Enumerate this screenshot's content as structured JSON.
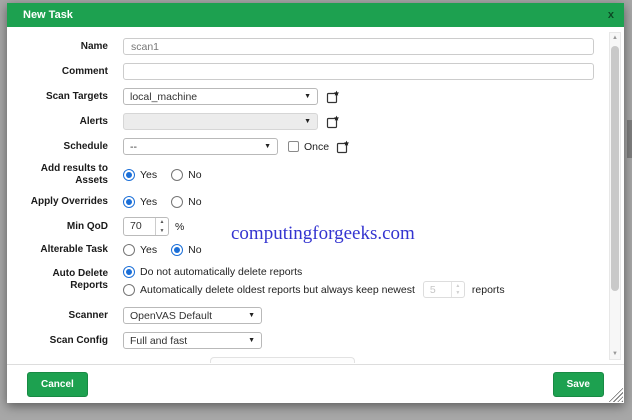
{
  "dialog": {
    "title": "New Task"
  },
  "icons": {
    "close": "x",
    "dropdown": "▼",
    "scroll_up": "▲",
    "scroll_down": "▼",
    "spin_up": "▲",
    "spin_down": "▼"
  },
  "watermark": "computingforgeeks.com",
  "form": {
    "name": {
      "label": "Name",
      "value": "scan1"
    },
    "comment": {
      "label": "Comment",
      "value": ""
    },
    "scan_targets": {
      "label": "Scan Targets",
      "value": "local_machine"
    },
    "alerts": {
      "label": "Alerts",
      "value": ""
    },
    "schedule": {
      "label": "Schedule",
      "value": "--",
      "once_label": "Once",
      "once_checked": false
    },
    "add_results": {
      "label": "Add results to Assets",
      "yes": "Yes",
      "no": "No",
      "selected": "Yes"
    },
    "apply_overrides": {
      "label": "Apply Overrides",
      "yes": "Yes",
      "no": "No",
      "selected": "Yes"
    },
    "min_qod": {
      "label": "Min QoD",
      "value": "70",
      "unit": "%"
    },
    "alterable": {
      "label": "Alterable Task",
      "yes": "Yes",
      "no": "No",
      "selected": "No"
    },
    "auto_delete": {
      "label": "Auto Delete Reports",
      "option_keep": "Do not automatically delete reports",
      "option_delete_prefix": "Automatically delete oldest reports but always keep newest",
      "keep_value": "5",
      "option_delete_suffix": "reports",
      "selected": "keep"
    },
    "scanner": {
      "label": "Scanner",
      "value": "OpenVAS Default"
    },
    "scan_config": {
      "label": "Scan Config",
      "value": "Full and fast"
    }
  },
  "footer": {
    "cancel": "Cancel",
    "save": "Save"
  },
  "colors": {
    "title_green": "#1da150",
    "button_green": "#1da150",
    "radio_blue": "#1b6fd8",
    "watermark_blue": "#3434d0",
    "backdrop_gray": "#a7a7a7"
  }
}
